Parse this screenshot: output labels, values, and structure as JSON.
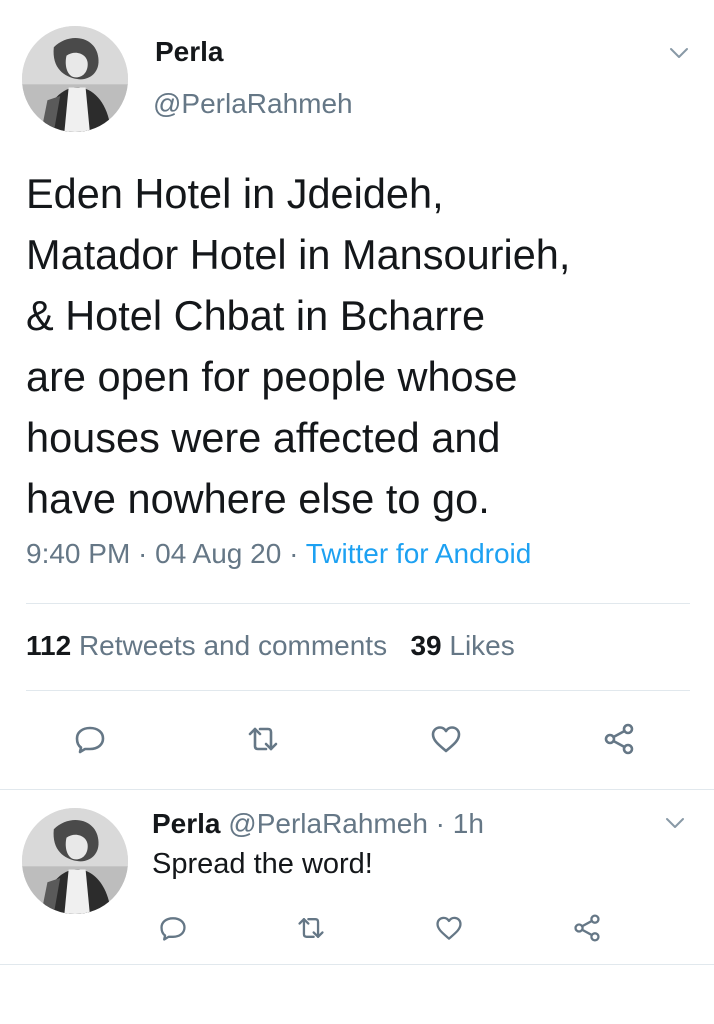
{
  "tweet": {
    "author_name": "Perla",
    "author_handle": "@PerlaRahmeh",
    "text_lines": [
      "Eden Hotel in Jdeideh,",
      "Matador Hotel in Mansourieh,",
      "& Hotel Chbat in Bcharre",
      "are open for people whose",
      "houses were affected and",
      "have nowhere else to go."
    ],
    "time": "9:40 PM",
    "date": "04 Aug 20",
    "separator": " · ",
    "source": "Twitter for Android",
    "retweets_count": "112",
    "retweets_label": "Retweets and comments",
    "likes_count": "39",
    "likes_label": "Likes"
  },
  "reply": {
    "author_name": "Perla",
    "author_handle": "@PerlaRahmeh",
    "time_ago": "1h",
    "separator": " · ",
    "text": "Spread the word!"
  },
  "colors": {
    "text": "#14171a",
    "secondary": "#657786",
    "link": "#1da1f2",
    "divider": "#e1e8ed"
  },
  "icons": {
    "caret": "chevron-down-icon",
    "reply": "reply-icon",
    "retweet": "retweet-icon",
    "like": "heart-icon",
    "share": "share-icon",
    "avatar": "avatar"
  }
}
